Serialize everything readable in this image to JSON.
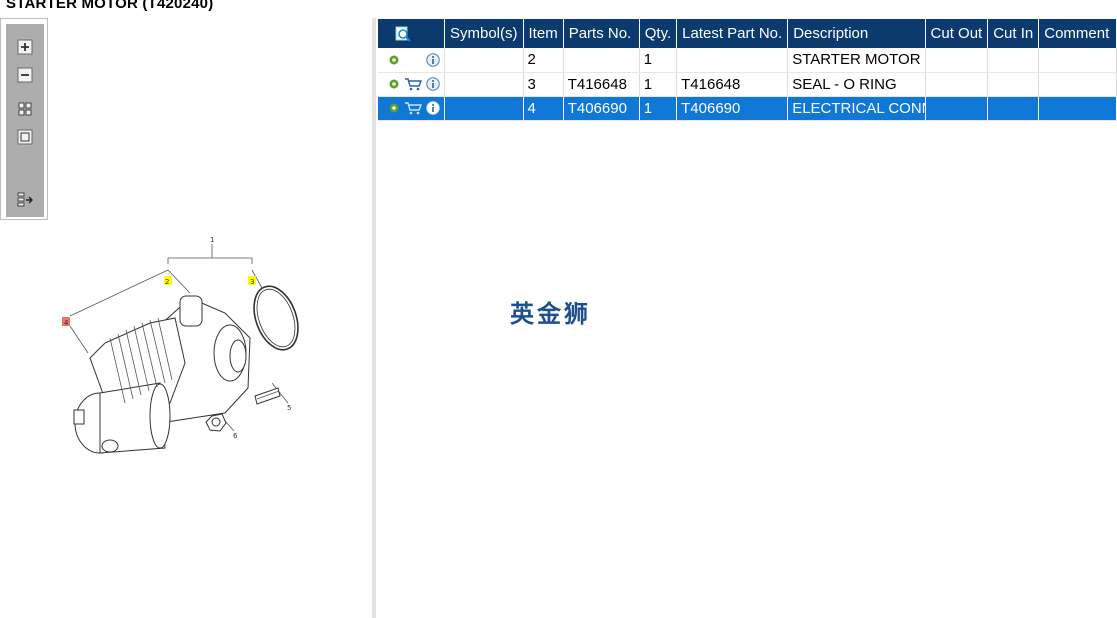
{
  "title": "STARTER MOTOR (T420240)",
  "toolbar": {
    "buttons": [
      "zoom-in-icon",
      "zoom-out-icon",
      "fit-grid-icon",
      "actual-size-icon",
      "list-export-icon"
    ]
  },
  "diagram": {
    "callouts": [
      "1",
      "2",
      "3",
      "4",
      "5",
      "6"
    ]
  },
  "table": {
    "columns": [
      "Symbol(s)",
      "Item",
      "Parts No.",
      "Qty.",
      "Latest Part No.",
      "Description",
      "Cut Out",
      "Cut In",
      "Comment"
    ],
    "rows": [
      {
        "item": "2",
        "parts_no": "",
        "qty": "1",
        "latest": "",
        "description": "STARTER MOTOR",
        "cart": false
      },
      {
        "item": "3",
        "parts_no": "T416648",
        "qty": "1",
        "latest": "T416648",
        "description": "SEAL - O RING",
        "cart": true
      },
      {
        "item": "4",
        "parts_no": "T406690",
        "qty": "1",
        "latest": "T406690",
        "description": "ELECTRICAL CONN",
        "cart": true
      }
    ]
  },
  "watermark": "英金狮",
  "colors": {
    "header_bg": "#0a3a6e",
    "selected_row": "#0f78d6",
    "callout_yellow": "#ffff00",
    "callout_red": "#f07070"
  }
}
